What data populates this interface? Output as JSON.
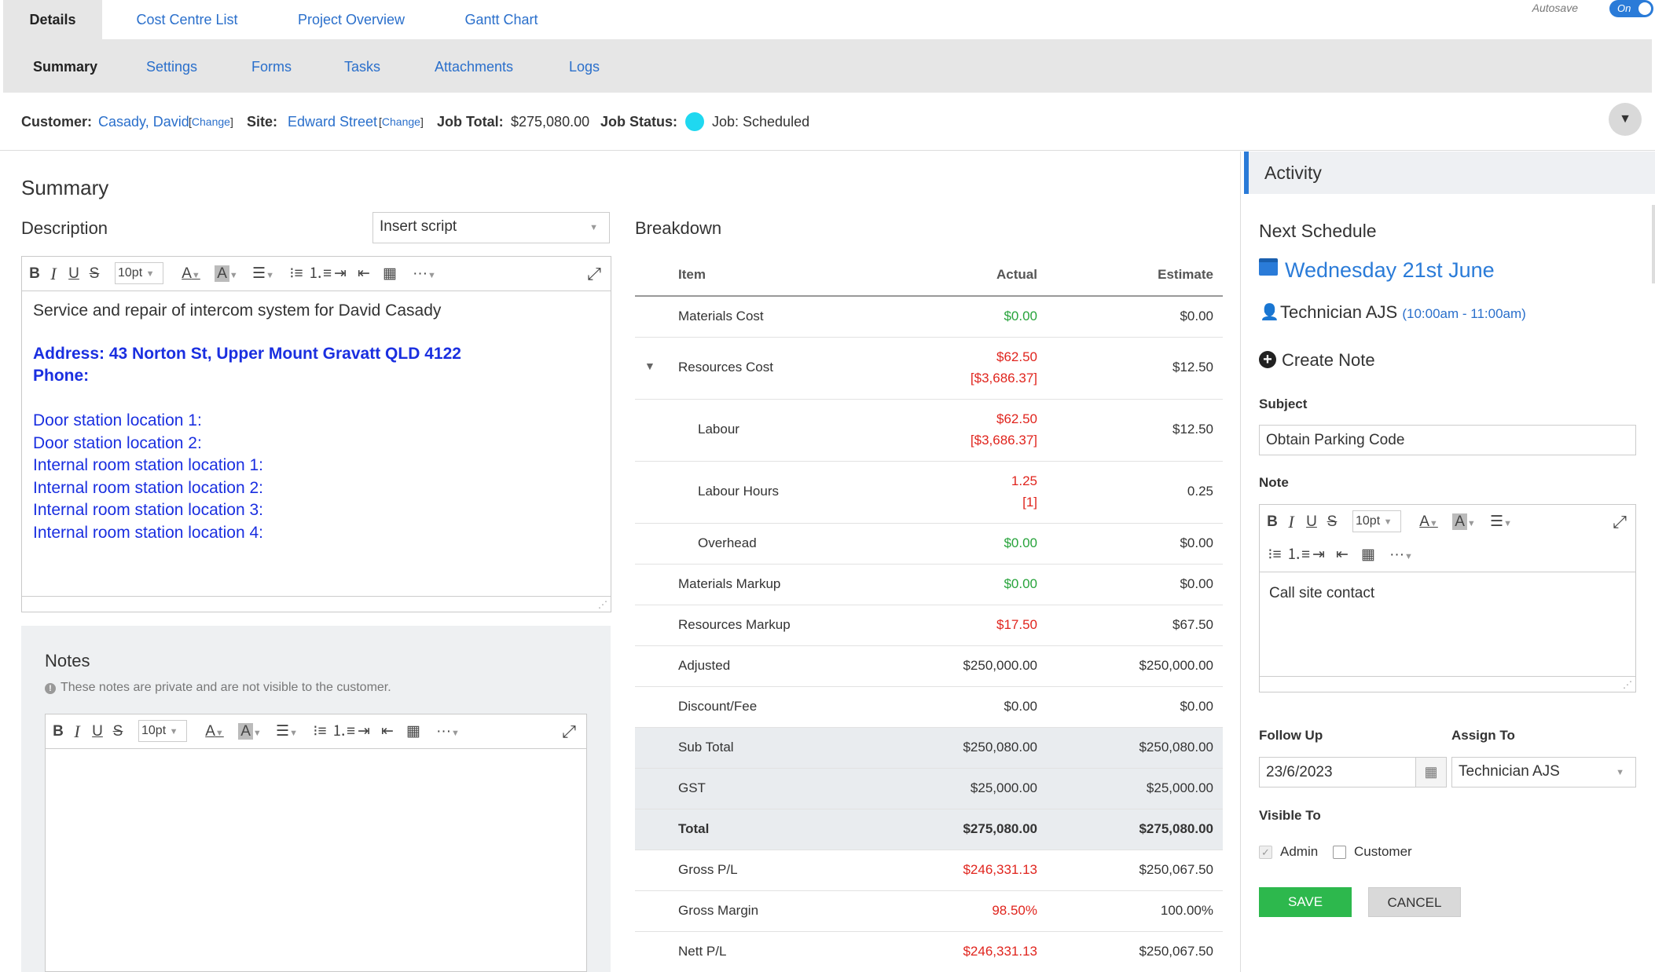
{
  "top_tabs": [
    "Details",
    "Cost Centre List",
    "Project Overview",
    "Gantt Chart"
  ],
  "autosave": {
    "label": "Autosave",
    "state": "On"
  },
  "sub_tabs": [
    "Summary",
    "Settings",
    "Forms",
    "Tasks",
    "Attachments",
    "Logs"
  ],
  "info": {
    "customer_label": "Customer:",
    "customer_value": "Casady, David",
    "change_text": "Change",
    "site_label": "Site:",
    "site_value": "Edward Street",
    "job_total_label": "Job Total:",
    "job_total_value": "$275,080.00",
    "job_status_label": "Job Status:",
    "job_status_value": "Job: Scheduled",
    "status_color": "#1fd8f0"
  },
  "summary": {
    "title": "Summary",
    "description_label": "Description",
    "insert_script_placeholder": "Insert script",
    "font_size": "10pt",
    "description_lines": [
      "Service and repair of intercom system for David Casady",
      "Address: 43 Norton St, Upper Mount Gravatt QLD 4122",
      "Phone:",
      "Door station location 1:",
      "Door station location 2:",
      "Internal room station location 1:",
      "Internal room station location 2:",
      "Internal room station location 3:",
      "Internal room station location 4:"
    ],
    "notes_title": "Notes",
    "notes_hint": "These notes are private and are not visible to the customer."
  },
  "breakdown": {
    "title": "Breakdown",
    "headers": {
      "item": "Item",
      "actual": "Actual",
      "estimate": "Estimate"
    },
    "rows": [
      {
        "item": "Materials Cost",
        "actual": "$0.00",
        "actual2": "",
        "estimate": "$0.00"
      },
      {
        "item": "Resources Cost",
        "actual": "$62.50",
        "actual2": "[$3,686.37]",
        "estimate": "$12.50"
      },
      {
        "item": "Labour",
        "actual": "$62.50",
        "actual2": "[$3,686.37]",
        "estimate": "$12.50"
      },
      {
        "item": "Labour Hours",
        "actual": "1.25",
        "actual2": "[1]",
        "estimate": "0.25"
      },
      {
        "item": "Overhead",
        "actual": "$0.00",
        "actual2": "",
        "estimate": "$0.00"
      },
      {
        "item": "Materials Markup",
        "actual": "$0.00",
        "actual2": "",
        "estimate": "$0.00"
      },
      {
        "item": "Resources Markup",
        "actual": "$17.50",
        "actual2": "",
        "estimate": "$67.50"
      },
      {
        "item": "Adjusted",
        "actual": "$250,000.00",
        "actual2": "",
        "estimate": "$250,000.00"
      },
      {
        "item": "Discount/Fee",
        "actual": "$0.00",
        "actual2": "",
        "estimate": "$0.00"
      },
      {
        "item": "Sub Total",
        "actual": "$250,080.00",
        "actual2": "",
        "estimate": "$250,080.00"
      },
      {
        "item": "GST",
        "actual": "$25,000.00",
        "actual2": "",
        "estimate": "$25,000.00"
      },
      {
        "item": "Total",
        "actual": "$275,080.00",
        "actual2": "",
        "estimate": "$275,080.00"
      },
      {
        "item": "Gross P/L",
        "actual": "$246,331.13",
        "actual2": "",
        "estimate": "$250,067.50"
      },
      {
        "item": "Gross Margin",
        "actual": "98.50%",
        "actual2": "",
        "estimate": "100.00%"
      },
      {
        "item": "Nett P/L",
        "actual": "$246,331.13",
        "actual2": "",
        "estimate": "$250,067.50"
      }
    ]
  },
  "activity": {
    "title": "Activity",
    "next_schedule_label": "Next Schedule",
    "schedule_date": "Wednesday 21st June",
    "technician": "Technician AJS",
    "time_range": "(10:00am - 11:00am)",
    "create_note_label": "Create Note",
    "subject_label": "Subject",
    "subject_value": "Obtain Parking Code",
    "note_label": "Note",
    "note_value": "Call site contact",
    "follow_up_label": "Follow Up",
    "follow_up_value": "23/6/2023",
    "assign_to_label": "Assign To",
    "assign_to_value": "Technician AJS",
    "visible_to_label": "Visible To",
    "visible_admin": "Admin",
    "visible_customer": "Customer",
    "save_label": "SAVE",
    "cancel_label": "CANCEL"
  },
  "colors": {
    "accent": "#2a7bd8",
    "link": "#2a6fcb",
    "save": "#2db84d",
    "positive": "#27a33b",
    "negative": "#e0241d"
  }
}
